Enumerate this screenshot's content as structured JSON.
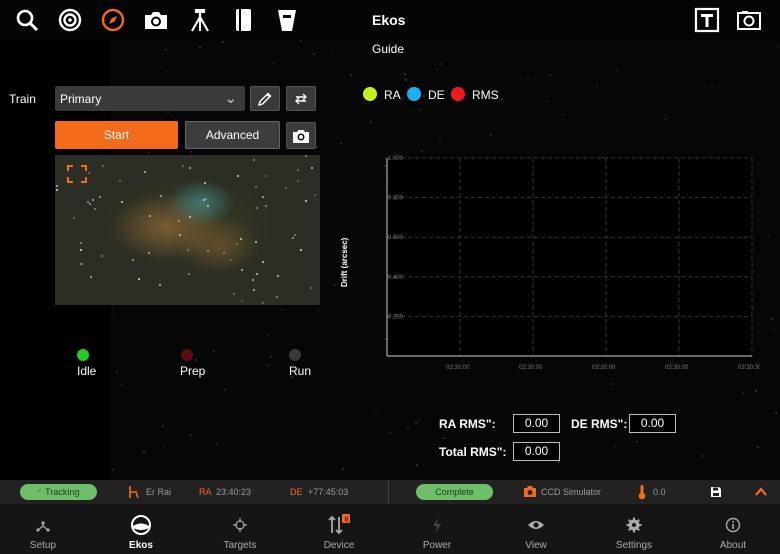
{
  "header": {
    "title": "Ekos",
    "subtitle": "Guide"
  },
  "toolbar": {
    "icons": [
      "search-icon",
      "target-icon",
      "compass-icon",
      "camera-icon",
      "tripod-icon",
      "notebook-icon",
      "filter-icon",
      "text-icon",
      "screenshot-icon"
    ],
    "active": "compass-icon",
    "accent": "#f46b1c"
  },
  "train": {
    "label": "Train",
    "selected": "Primary"
  },
  "controls": {
    "start_label": "Start",
    "advanced_label": "Advanced"
  },
  "stages": [
    {
      "label": "Idle",
      "color": "#22cc22"
    },
    {
      "label": "Prep",
      "color": "#5a1010"
    },
    {
      "label": "Run",
      "color": "#3a3a3a"
    }
  ],
  "legend": [
    {
      "label": "RA",
      "color": "#c6f01a"
    },
    {
      "label": "DE",
      "color": "#1ab0ee"
    },
    {
      "label": "RMS",
      "color": "#ee1a1a"
    }
  ],
  "chart_data": {
    "type": "line",
    "ylabel": "Drift (arcsec)",
    "ylim": [
      0,
      1.0
    ],
    "yticks": [
      "1.000",
      "0.800",
      "0.600",
      "0.400",
      "0.200"
    ],
    "xticks": [
      "03:30:00",
      "03:30:00",
      "03:30:00",
      "03:30:00",
      "03:30:30"
    ],
    "series": [],
    "grid": true
  },
  "rms": {
    "ra_label": "RA RMS\":",
    "ra_value": "0.00",
    "de_label": "DE RMS\":",
    "de_value": "0.00",
    "total_label": "Total RMS\":",
    "total_value": "0.00"
  },
  "status": {
    "tracking": "Tracking",
    "mount": "Er Rai",
    "ra_key": "RA",
    "ra_value": "23:40:23",
    "de_key": "DE",
    "de_value": "+77:45:03",
    "complete": "Complete",
    "camera": "CCD Simulator",
    "temp": "0.0"
  },
  "nav": [
    {
      "label": "Setup",
      "icon": "setup-icon"
    },
    {
      "label": "Ekos",
      "icon": "ekos-icon",
      "active": true
    },
    {
      "label": "Targets",
      "icon": "targets-icon"
    },
    {
      "label": "Device",
      "icon": "device-icon"
    },
    {
      "label": "Power",
      "icon": "power-icon"
    },
    {
      "label": "View",
      "icon": "view-icon"
    },
    {
      "label": "Settings",
      "icon": "settings-icon"
    },
    {
      "label": "About",
      "icon": "about-icon"
    }
  ]
}
